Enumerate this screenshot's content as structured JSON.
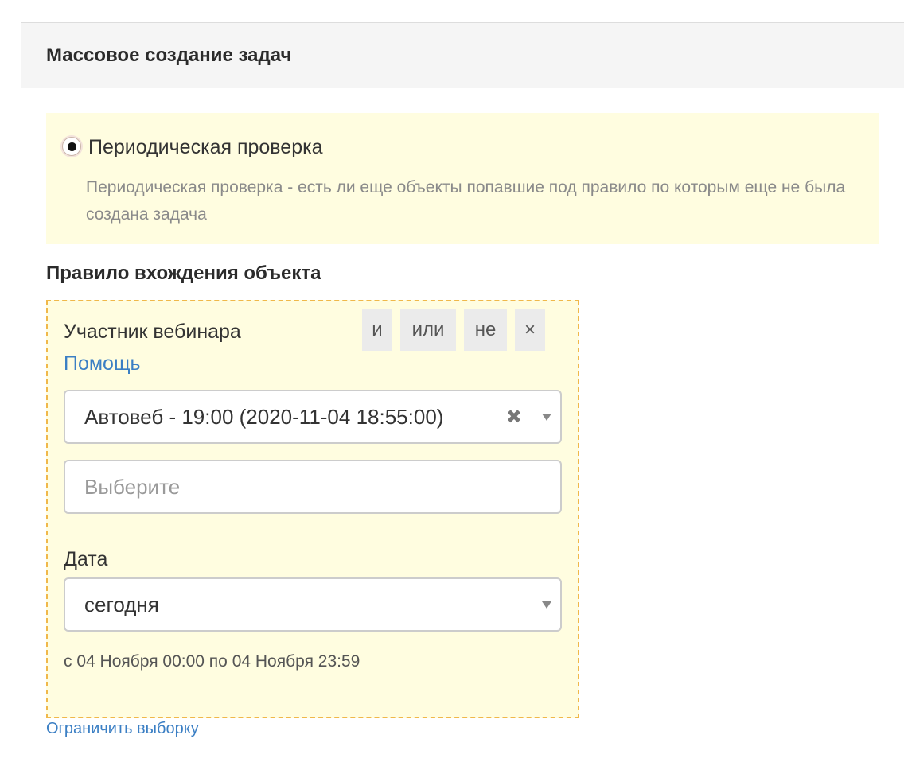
{
  "panel": {
    "title": "Массовое создание задач"
  },
  "periodic": {
    "label": "Периодическая проверка",
    "selected": true,
    "description": "Периодическая проверка - есть ли еще объекты попавшие под правило по которым еще не была создана задача"
  },
  "rule": {
    "title": "Правило вхождения объекта",
    "condition": {
      "name": "Участник вебинара",
      "help_label": "Помощь",
      "operators": [
        {
          "label": "и"
        },
        {
          "label": "или"
        },
        {
          "label": "не"
        },
        {
          "label": "×"
        }
      ],
      "webinar_select": {
        "value": "Автовеб - 19:00 (2020-11-04 18:55:00)",
        "clear_glyph": "✖"
      },
      "extra_select": {
        "placeholder": "Выберите"
      },
      "date": {
        "label": "Дата",
        "value": "сегодня",
        "range_text": "с 04 Ноября 00:00 по 04 Ноября 23:59"
      }
    },
    "limit_label": "Ограничить выборку"
  }
}
